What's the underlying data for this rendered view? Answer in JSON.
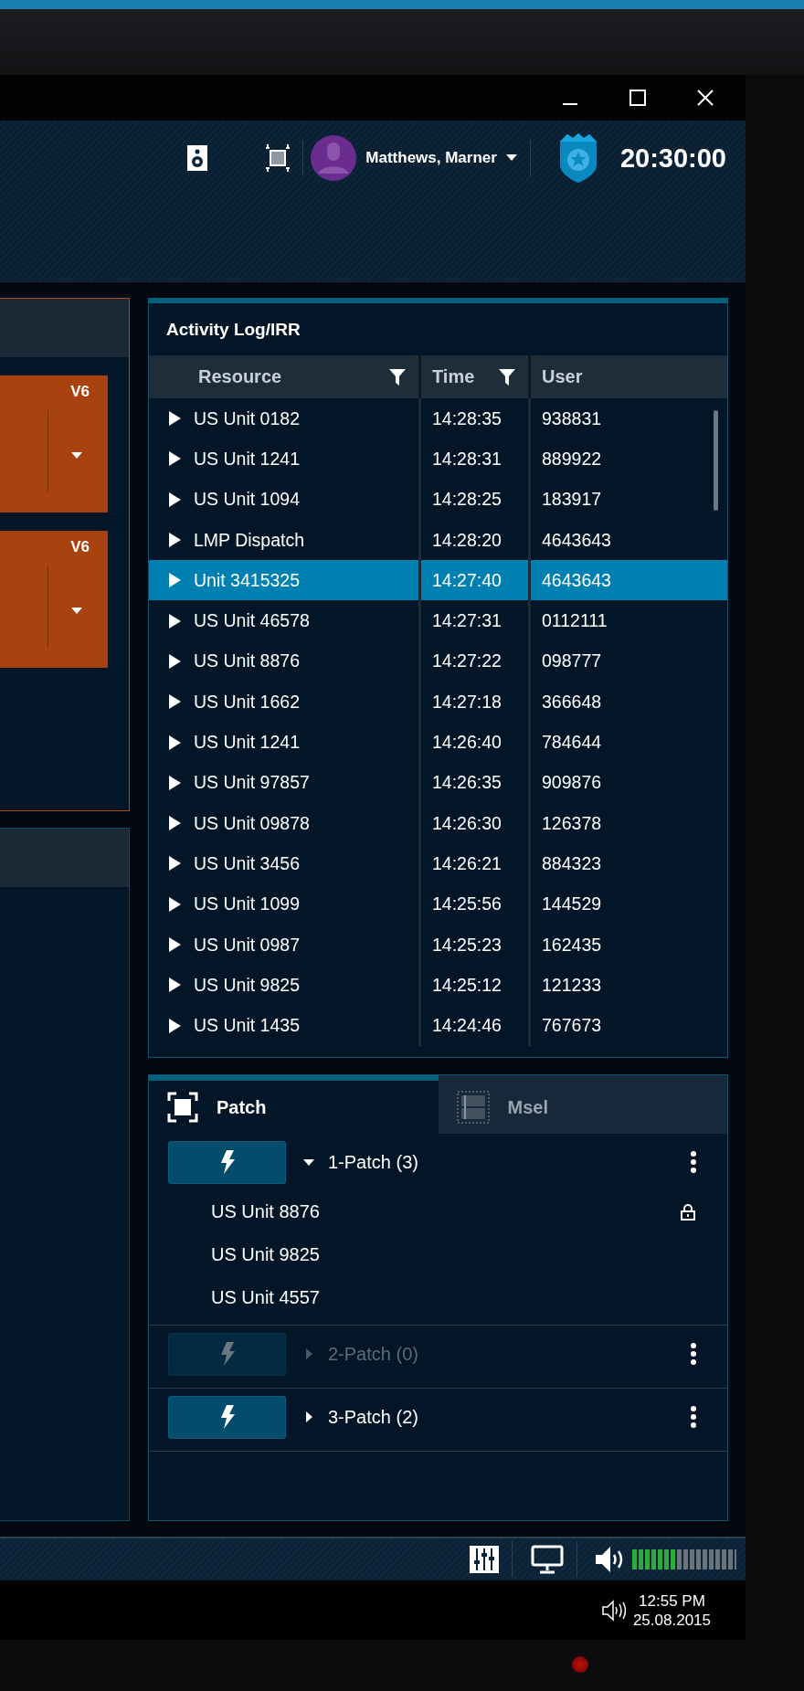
{
  "header": {
    "user_name": "Matthews, Marner",
    "clock": "20:30:00"
  },
  "left_panel": {
    "cards": [
      {
        "label": "V6"
      },
      {
        "label": "V6"
      }
    ]
  },
  "activity_log": {
    "title": "Activity Log/IRR",
    "columns": [
      {
        "label": "Resource",
        "filter": true
      },
      {
        "label": "Time",
        "filter": true
      },
      {
        "label": "User",
        "filter": false
      }
    ],
    "rows": [
      {
        "resource": "US Unit 0182",
        "time": "14:28:35",
        "user": "938831",
        "selected": false
      },
      {
        "resource": "US Unit 1241",
        "time": "14:28:31",
        "user": "889922",
        "selected": false
      },
      {
        "resource": "US Unit 1094",
        "time": "14:28:25",
        "user": "183917",
        "selected": false
      },
      {
        "resource": "LMP Dispatch",
        "time": "14:28:20",
        "user": "4643643",
        "selected": false
      },
      {
        "resource": "Unit 3415325",
        "time": "14:27:40",
        "user": "4643643",
        "selected": true
      },
      {
        "resource": "US Unit 46578",
        "time": "14:27:31",
        "user": "0112111",
        "selected": false
      },
      {
        "resource": "US Unit 8876",
        "time": "14:27:22",
        "user": "098777",
        "selected": false
      },
      {
        "resource": "US Unit 1662",
        "time": "14:27:18",
        "user": "366648",
        "selected": false
      },
      {
        "resource": "US Unit 1241",
        "time": "14:26:40",
        "user": "784644",
        "selected": false
      },
      {
        "resource": "US Unit 97857",
        "time": "14:26:35",
        "user": "909876",
        "selected": false
      },
      {
        "resource": "US Unit 09878",
        "time": "14:26:30",
        "user": "126378",
        "selected": false
      },
      {
        "resource": "US Unit 3456",
        "time": "14:26:21",
        "user": "884323",
        "selected": false
      },
      {
        "resource": "US Unit 1099",
        "time": "14:25:56",
        "user": "144529",
        "selected": false
      },
      {
        "resource": "US Unit 0987",
        "time": "14:25:23",
        "user": "162435",
        "selected": false
      },
      {
        "resource": "US Unit 9825",
        "time": "14:25:12",
        "user": "121233",
        "selected": false
      },
      {
        "resource": "US Unit 1435",
        "time": "14:24:46",
        "user": "767673",
        "selected": false
      }
    ]
  },
  "patch_panel": {
    "tabs": [
      {
        "label": "Patch",
        "kind": "patch",
        "selected": true
      },
      {
        "label": "Msel",
        "kind": "msel",
        "selected": false
      }
    ],
    "groups": [
      {
        "label": "1-Patch (3)",
        "expanded": true,
        "disabled": false,
        "children": [
          {
            "name": "US Unit 8876",
            "locked": true
          },
          {
            "name": "US Unit 9825",
            "locked": false
          },
          {
            "name": "US Unit 4557",
            "locked": false
          }
        ]
      },
      {
        "label": "2-Patch (0)",
        "expanded": false,
        "disabled": true
      },
      {
        "label": "3-Patch (2)",
        "expanded": false,
        "disabled": false
      }
    ]
  },
  "toolbar": {
    "volume": {
      "level": 0.44
    }
  },
  "taskbar": {
    "time": "12:55 PM",
    "date": "25.08.2015"
  }
}
